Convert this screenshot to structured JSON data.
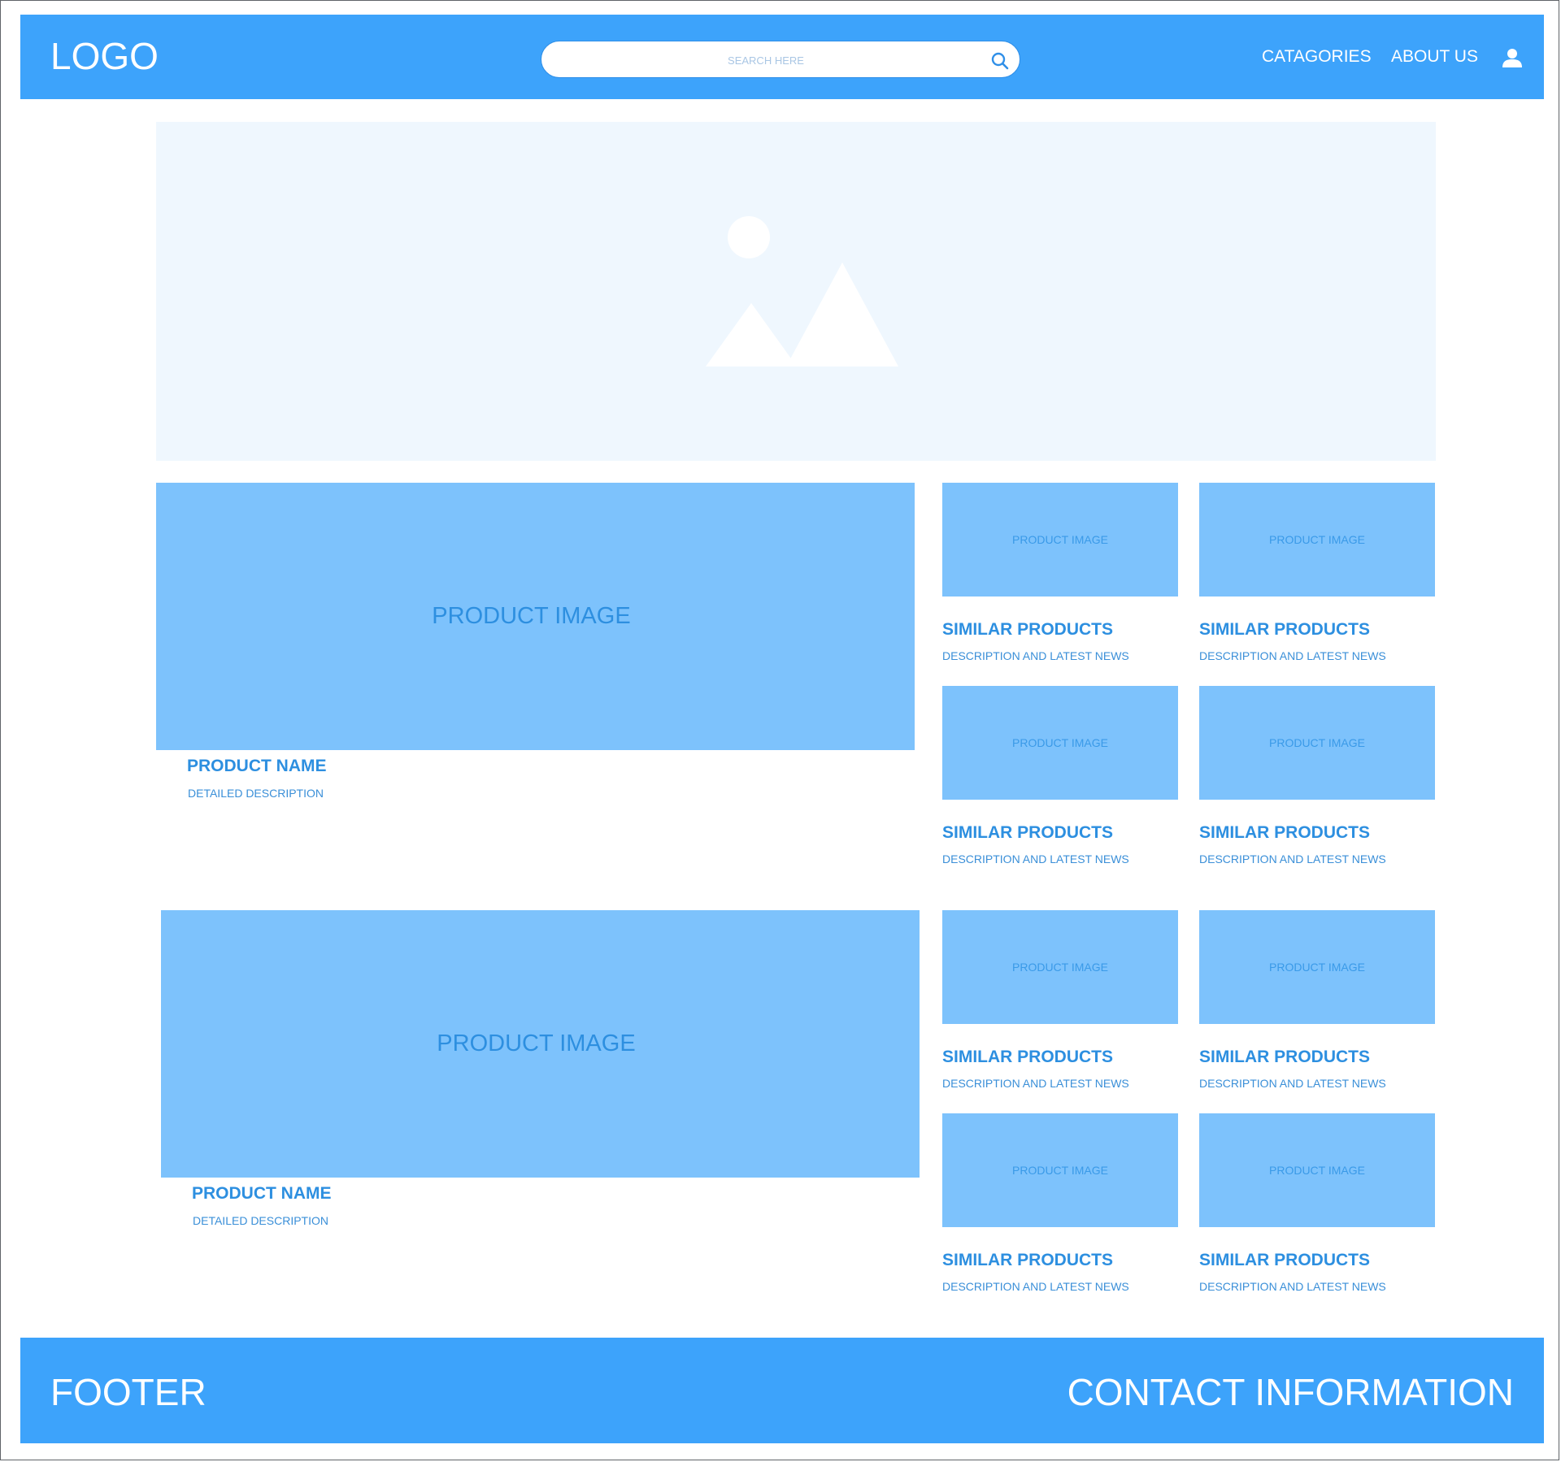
{
  "header": {
    "logo": "LOGO",
    "search_placeholder": "SEARCH HERE",
    "nav": [
      "CATAGORIES",
      "ABOUT US"
    ],
    "user_icon": "user-icon",
    "search_icon": "search-icon"
  },
  "hero": {
    "icon": "image-placeholder-icon"
  },
  "sections": [
    {
      "image_label": "PRODUCT IMAGE",
      "product_name": "PRODUCT NAME",
      "description": "DETAILED DESCRIPTION",
      "similar": [
        {
          "image_label": "PRODUCT IMAGE",
          "title": "SIMILAR PRODUCTS",
          "desc": "DESCRIPTION AND LATEST NEWS"
        },
        {
          "image_label": "PRODUCT IMAGE",
          "title": "SIMILAR PRODUCTS",
          "desc": "DESCRIPTION AND LATEST NEWS"
        },
        {
          "image_label": "PRODUCT IMAGE",
          "title": "SIMILAR PRODUCTS",
          "desc": "DESCRIPTION AND LATEST NEWS"
        },
        {
          "image_label": "PRODUCT IMAGE",
          "title": "SIMILAR PRODUCTS",
          "desc": "DESCRIPTION AND LATEST NEWS"
        }
      ]
    },
    {
      "image_label": "PRODUCT IMAGE",
      "product_name": "PRODUCT NAME",
      "description": "DETAILED DESCRIPTION",
      "similar": [
        {
          "image_label": "PRODUCT IMAGE",
          "title": "SIMILAR PRODUCTS",
          "desc": "DESCRIPTION AND LATEST NEWS"
        },
        {
          "image_label": "PRODUCT IMAGE",
          "title": "SIMILAR PRODUCTS",
          "desc": "DESCRIPTION AND LATEST NEWS"
        },
        {
          "image_label": "PRODUCT IMAGE",
          "title": "SIMILAR PRODUCTS",
          "desc": "DESCRIPTION AND LATEST NEWS"
        },
        {
          "image_label": "PRODUCT IMAGE",
          "title": "SIMILAR PRODUCTS",
          "desc": "DESCRIPTION AND LATEST NEWS"
        }
      ]
    }
  ],
  "footer": {
    "left": "FOOTER",
    "right": "CONTACT INFORMATION"
  },
  "colors": {
    "bar": "#3da3fb",
    "card": "#7dc2fc",
    "hero_bg": "#eff7fe",
    "accent_text": "#2d8fe0"
  }
}
